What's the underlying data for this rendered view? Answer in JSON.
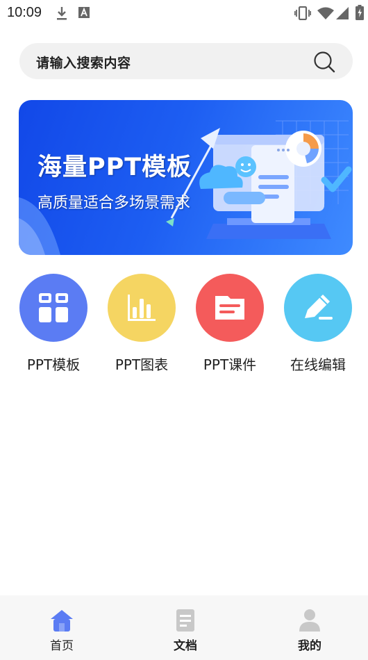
{
  "status_bar": {
    "time": "10:09"
  },
  "search": {
    "placeholder": "请输入搜索内容"
  },
  "banner": {
    "title": "海量PPT模板",
    "subtitle": "高质量适合多场景需求"
  },
  "categories": [
    {
      "label": "PPT模板",
      "color": "#5b7cf3",
      "icon": "grid-icon"
    },
    {
      "label": "PPT图表",
      "color": "#f5d562",
      "icon": "bar-chart-icon"
    },
    {
      "label": "PPT课件",
      "color": "#f45b5b",
      "icon": "document-icon"
    },
    {
      "label": "在线编辑",
      "color": "#56c8f3",
      "icon": "pen-icon"
    }
  ],
  "bottom_nav": {
    "items": [
      {
        "label": "首页",
        "icon": "home-icon",
        "active": true,
        "color": "#5b7cf3"
      },
      {
        "label": "文档",
        "icon": "file-icon",
        "active": false,
        "color": "#c8c8c8"
      },
      {
        "label": "我的",
        "icon": "user-icon",
        "active": false,
        "color": "#c8c8c8"
      }
    ]
  }
}
